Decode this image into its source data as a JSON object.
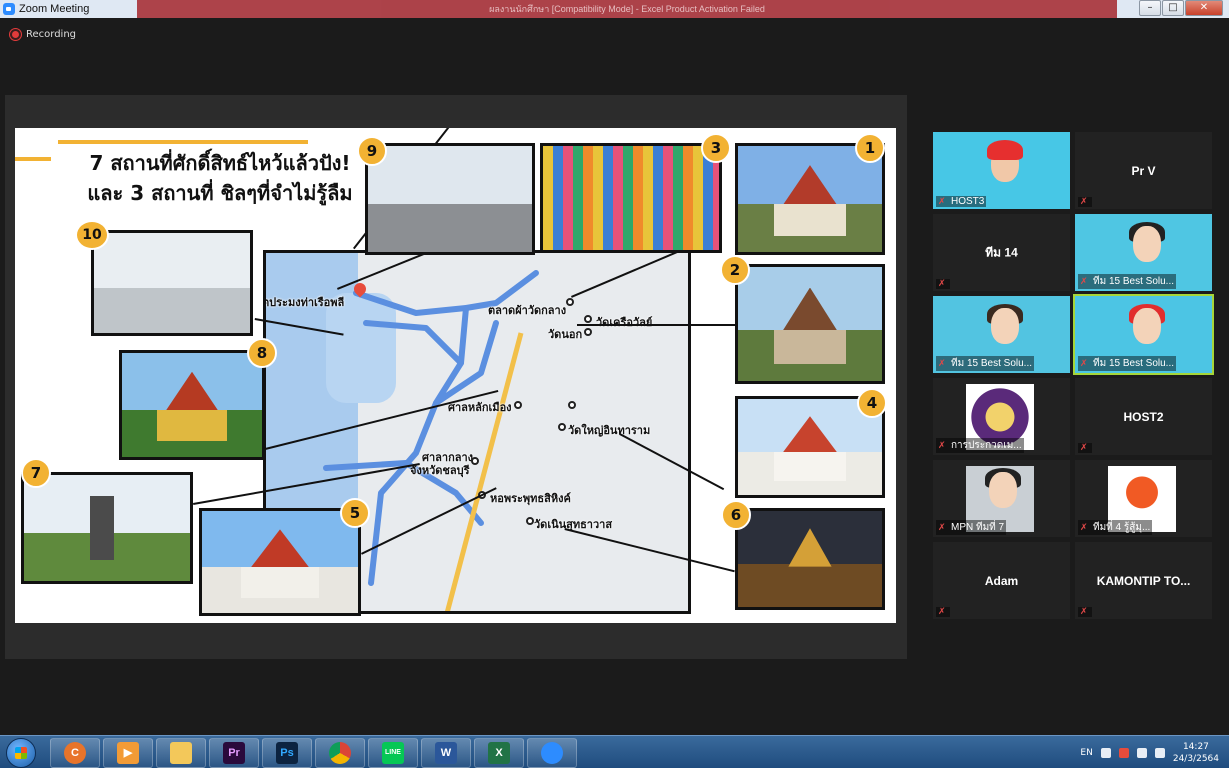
{
  "window": {
    "title": "Zoom Meeting",
    "ppt_title": "ผลงานนักศึกษา [Compatibility Mode] - Excel Product Activation Failed"
  },
  "recording": {
    "label": "Recording"
  },
  "slide": {
    "heading_line1": "7 สถานที่ศักดิ์สิทธ์ไหว้แล้วปัง!",
    "heading_line2": "และ 3 สถานที่ ชิลๆที่จำไม่รู้ลืม",
    "map_labels": [
      "ตลาดผ้าวัดกลาง",
      "วัดเครือวัลย์",
      "วัดนอก",
      "ศาลหลักเมือง",
      "วัดใหญ่อินทาราม",
      "ศาลากลาง",
      "จังหวัดชลบุรี",
      "หอพระพุทธสิหิงค์",
      "วัดเนินสุทธาวาส",
      "ตประมงท่าเรือพลี"
    ],
    "badges": [
      "1",
      "2",
      "3",
      "4",
      "5",
      "6",
      "7",
      "8",
      "9",
      "10"
    ]
  },
  "participants": [
    {
      "name": "HOST3",
      "muted": true
    },
    {
      "name": "Pr V",
      "muted": true
    },
    {
      "name": "ทีม 14",
      "muted": true
    },
    {
      "name": "ทีม 15 Best Solu...",
      "muted": true
    },
    {
      "name": "ทีม 15 Best Solu...",
      "muted": true
    },
    {
      "name": "ทีม 15 Best Solu...",
      "muted": true
    },
    {
      "name": "การประกวดเม...",
      "muted": true
    },
    {
      "name": "HOST2",
      "muted": true
    },
    {
      "name": "MPN ทีมที่ 7",
      "muted": true
    },
    {
      "name": "ทีมที่ 4 รู้สู้มุ...",
      "muted": true
    },
    {
      "name": "Adam",
      "muted": true
    },
    {
      "name": "KAMONTIP TO...",
      "muted": true
    }
  ],
  "taskbar": {
    "apps": [
      "ccleaner-app",
      "media-player-app",
      "file-explorer-app",
      "premiere-app",
      "photoshop-app",
      "chrome-app",
      "line-app",
      "word-app",
      "excel-app",
      "zoom-app"
    ],
    "app_letters": [
      "C",
      "▶",
      "",
      "Pr",
      "Ps",
      "",
      "LINE",
      "W",
      "X",
      ""
    ],
    "language": "EN",
    "time": "14:27",
    "date": "24/3/2564"
  },
  "colors": {
    "accent_gold": "#f2b233",
    "zoom_blue": "#2d8cff",
    "active_border": "#a6d639"
  }
}
